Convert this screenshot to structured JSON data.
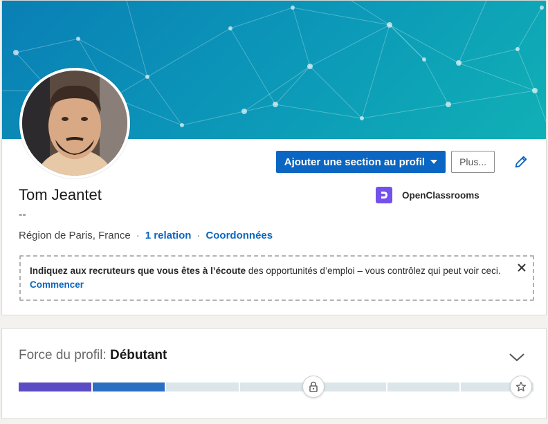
{
  "profile": {
    "name": "Tom Jeantet",
    "headline": "--",
    "location": "Région de Paris, France",
    "separator": "·",
    "connections_link": "1 relation",
    "contact_link": "Coordonnées"
  },
  "actions": {
    "add_section_label": "Ajouter une section au profil",
    "more_label": "Plus..."
  },
  "company": {
    "name": "OpenClassrooms",
    "logo_color": "#7451eb"
  },
  "notice": {
    "bold_text": "Indiquez aux recruteurs que vous êtes à l’écoute",
    "text": " des opportunités d’emploi – vous contrôlez qui peut voir ceci.",
    "cta": "Commencer"
  },
  "strength": {
    "label": "Force du profil:",
    "level": "Débutant",
    "segments_total": 7,
    "segments_filled": 2
  },
  "colors": {
    "primary": "#0a66c2",
    "meter_1": "#5b4cc4",
    "meter_2": "#2a6fc1"
  }
}
